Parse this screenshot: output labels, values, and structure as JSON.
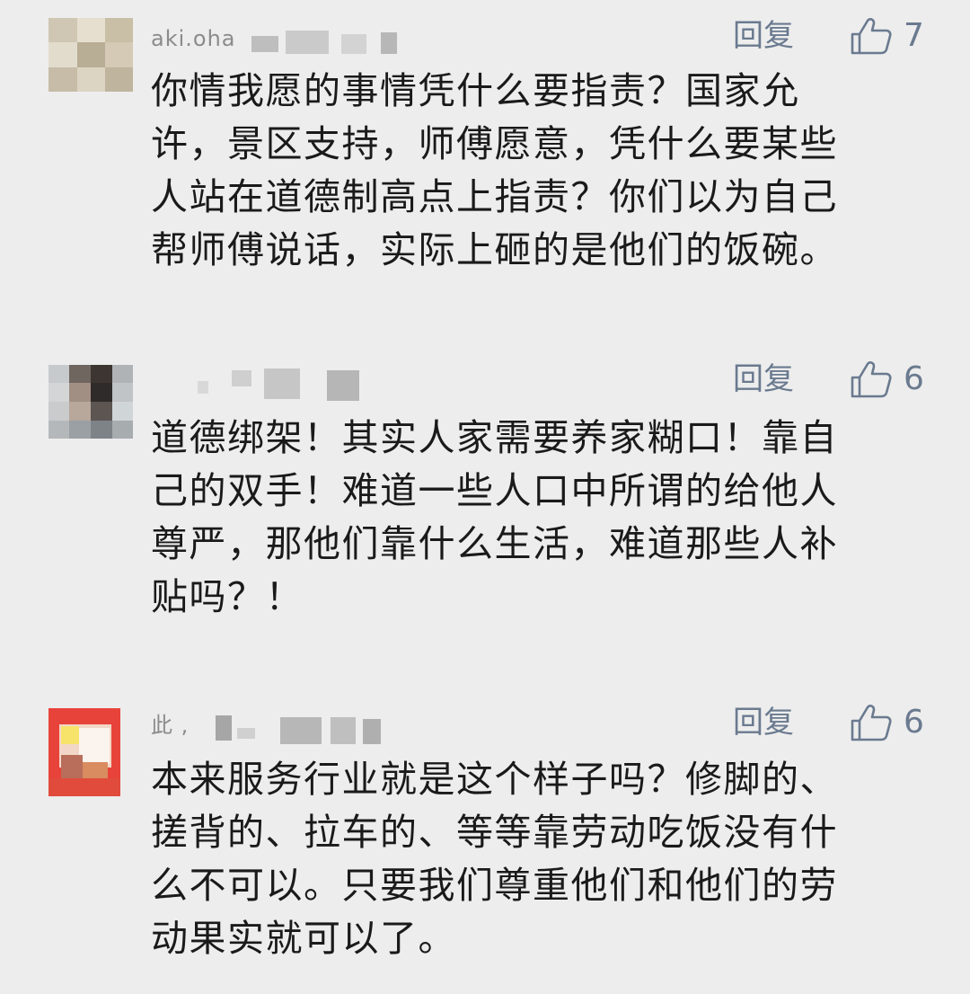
{
  "comments": [
    {
      "username": "aki.oha",
      "reply_label": "回复",
      "like_icon": "thumbs-up-icon",
      "likes": "7",
      "text": "你情我愿的事情凭什么要指责？国家允\n许，景区支持，师傅愿意，凭什么要某些\n人站在道德制高点上指责？你们以为自己\n帮师傅说话，实际上砸的是他们的饭碗。"
    },
    {
      "username": "",
      "reply_label": "回复",
      "like_icon": "thumbs-up-icon",
      "likes": "6",
      "text": "道德绑架！其实人家需要养家糊口！靠自\n己的双手！难道一些人口中所谓的给他人\n尊严，那他们靠什么生活，难道那些人补\n贴吗？！"
    },
    {
      "username": "此 ,",
      "reply_label": "回复",
      "like_icon": "thumbs-up-icon",
      "likes": "6",
      "text": "本来服务行业就是这个样子吗？修脚的、\n搓背的、拉车的、等等靠劳动吃饭没有什\n么不可以。只要我们尊重他们和他们的劳\n动果实就可以了。"
    }
  ],
  "colors": {
    "background": "#ededed",
    "text": "#1a1a1a",
    "action": "#6a7a8f"
  }
}
